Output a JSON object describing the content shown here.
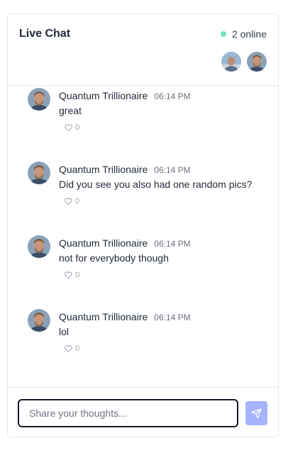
{
  "header": {
    "title": "Live Chat",
    "online_text": "2 online",
    "online_color": "#6ee7b7"
  },
  "participants": [
    {
      "avatar_icon": "user-avatar-icon"
    },
    {
      "avatar_icon": "user-avatar-icon"
    }
  ],
  "messages": [
    {
      "author": "Quantum Trillionaire",
      "time": "06:14 PM",
      "text": "great",
      "likes": "0"
    },
    {
      "author": "Quantum Trillionaire",
      "time": "06:14 PM",
      "text": "Did you see you also had one random pics?",
      "likes": "0"
    },
    {
      "author": "Quantum Trillionaire",
      "time": "06:14 PM",
      "text": "not for everybody though",
      "likes": "0"
    },
    {
      "author": "Quantum Trillionaire",
      "time": "06:14 PM",
      "text": "lol",
      "likes": "0"
    }
  ],
  "composer": {
    "placeholder": "Share your thoughts...",
    "value": "",
    "send_icon": "send-icon",
    "send_color": "#a5b4fc"
  }
}
